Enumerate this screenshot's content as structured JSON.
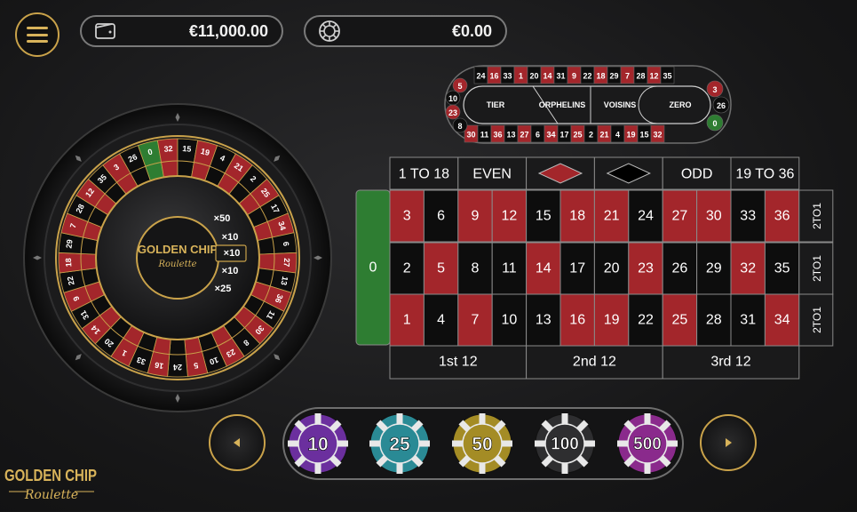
{
  "balance": {
    "amount": "€11,000.00"
  },
  "total_bet": {
    "amount": "€0.00"
  },
  "wheel": {
    "numbers": [
      "0",
      "32",
      "15",
      "19",
      "4",
      "21",
      "2",
      "25",
      "17",
      "34",
      "6",
      "27",
      "13",
      "36",
      "11",
      "30",
      "8",
      "23",
      "10",
      "5",
      "24",
      "16",
      "33",
      "1",
      "20",
      "14",
      "31",
      "9",
      "22",
      "18",
      "29",
      "7",
      "28",
      "12",
      "35",
      "3",
      "26"
    ],
    "logo_line1": "GOLDEN CHIP",
    "logo_line2": "Roulette",
    "multipliers": [
      "×50",
      "×10",
      "×10",
      "×10",
      "×25"
    ]
  },
  "racetrack": {
    "top_row": [
      "24",
      "16",
      "33",
      "1",
      "20",
      "14",
      "31",
      "9",
      "22",
      "18",
      "29",
      "7",
      "28",
      "12",
      "35"
    ],
    "bottom_row": [
      "30",
      "11",
      "36",
      "13",
      "27",
      "6",
      "34",
      "17",
      "25",
      "2",
      "21",
      "4",
      "19",
      "15",
      "32"
    ],
    "left_end": [
      "5",
      "10",
      "23",
      "8"
    ],
    "right_end": [
      "3",
      "26",
      "0"
    ],
    "sections": [
      "TIER",
      "ORPHELINS",
      "VOISINS",
      "ZERO"
    ]
  },
  "board": {
    "outside_top": [
      "1 TO 18",
      "EVEN",
      "",
      "",
      "ODD",
      "19 TO 36"
    ],
    "zero": "0",
    "rows": [
      [
        "3",
        "6",
        "9",
        "12",
        "15",
        "18",
        "21",
        "24",
        "27",
        "30",
        "33",
        "36"
      ],
      [
        "2",
        "5",
        "8",
        "11",
        "14",
        "17",
        "20",
        "23",
        "26",
        "29",
        "32",
        "35"
      ],
      [
        "1",
        "4",
        "7",
        "10",
        "13",
        "16",
        "19",
        "22",
        "25",
        "28",
        "31",
        "34"
      ]
    ],
    "column_bets": [
      "2TO1",
      "2TO1",
      "2TO1"
    ],
    "dozens": [
      "1st 12",
      "2nd 12",
      "3rd 12"
    ],
    "red_numbers": [
      "1",
      "3",
      "5",
      "7",
      "9",
      "12",
      "14",
      "16",
      "18",
      "19",
      "21",
      "23",
      "25",
      "27",
      "30",
      "32",
      "34",
      "36"
    ]
  },
  "chips": [
    {
      "value": "10",
      "color": "#6b2f9e"
    },
    {
      "value": "25",
      "color": "#2a8a95"
    },
    {
      "value": "50",
      "color": "#a48c25"
    },
    {
      "value": "100",
      "color": "#2e2e30"
    },
    {
      "value": "500",
      "color": "#8a2a8c"
    }
  ],
  "colors": {
    "red": "#a3262b",
    "black": "#0d0d0d",
    "green": "#2e7d32",
    "gold": "#c9a24a"
  },
  "logo": {
    "line1": "GOLDEN CHIP",
    "line2": "Roulette"
  }
}
